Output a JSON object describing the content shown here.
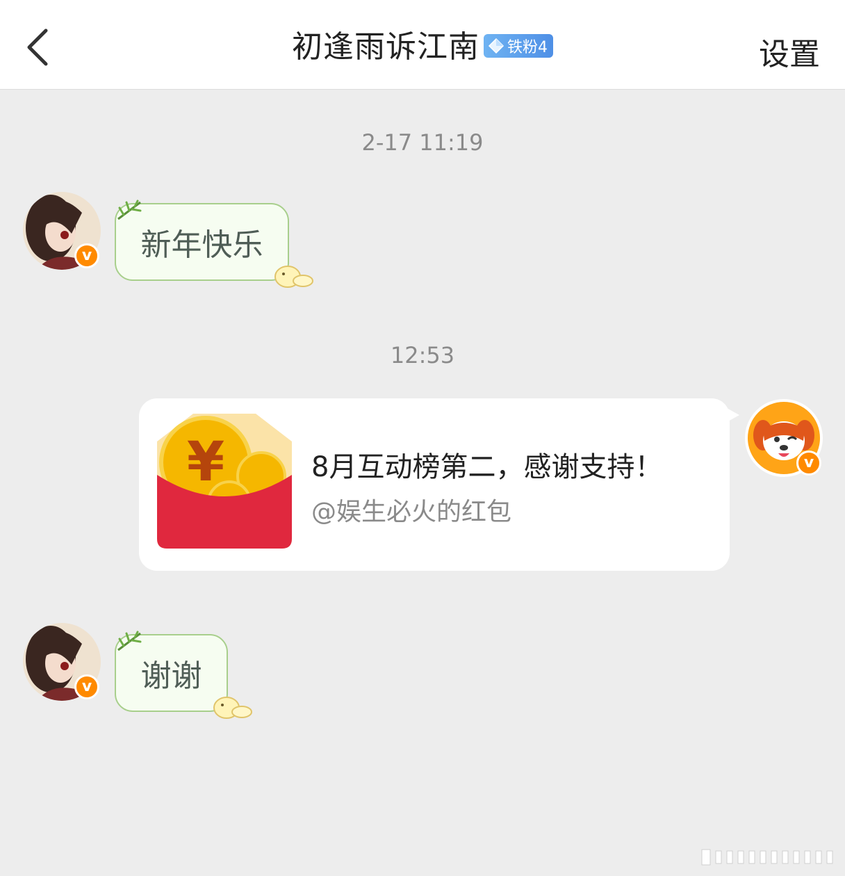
{
  "header": {
    "title": "初逢雨诉江南",
    "fan_badge": "铁粉4",
    "settings_label": "设置"
  },
  "messages": {
    "ts1": "2-17 11:19",
    "m1_text": "新年快乐",
    "ts2": "12:53",
    "redpacket_title": "8月互动榜第二，感谢支持！",
    "redpacket_sub": "@娱生必火的红包",
    "m3_text": "谢谢"
  },
  "colors": {
    "accent_badge": "#4e8fe6",
    "verified_badge": "#ff8a00",
    "bubble_green_bg": "#f6fdf1",
    "bubble_green_border": "#a8cf8c",
    "redpacket_red": "#e0283e",
    "coin_gold": "#f5b700"
  },
  "icons": {
    "back": "chevron-left-icon",
    "fan_badge": "diamond-icon",
    "verified": "v-verified-icon",
    "redpacket": "red-envelope-icon"
  }
}
